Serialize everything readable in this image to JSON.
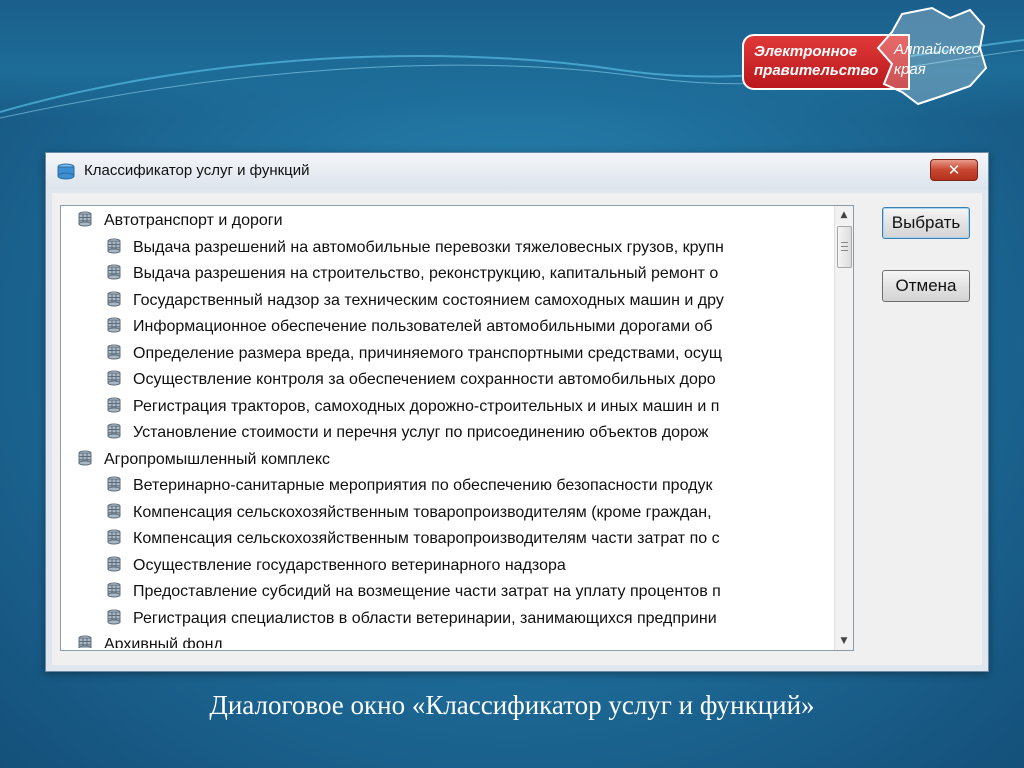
{
  "logo": {
    "red_text": "Электронное\nправительство",
    "map_text": "Алтайского\nкрая"
  },
  "dialog": {
    "title": "Классификатор услуг и функций",
    "close_label": "✕",
    "buttons": {
      "select": "Выбрать",
      "cancel": "Отмена"
    },
    "tree": [
      {
        "type": "group",
        "label": "Автотранспорт и дороги"
      },
      {
        "type": "child",
        "label": "Выдача разрешений на автомобильные перевозки тяжеловесных грузов, крупн"
      },
      {
        "type": "child",
        "label": "Выдача разрешения на строительство, реконструкцию, капитальный ремонт о"
      },
      {
        "type": "child",
        "label": "Государственный надзор за техническим состоянием самоходных машин и дру"
      },
      {
        "type": "child",
        "label": "Информационное обеспечение пользователей автомобильными дорогами об"
      },
      {
        "type": "child",
        "label": "Определение размера вреда, причиняемого транспортными средствами, осущ"
      },
      {
        "type": "child",
        "label": "Осуществление контроля за обеспечением сохранности автомобильных доро"
      },
      {
        "type": "child",
        "label": "Регистрация тракторов, самоходных дорожно-строительных и иных машин и п"
      },
      {
        "type": "child",
        "label": "Установление стоимости и перечня услуг по присоединению объектов дорож"
      },
      {
        "type": "group",
        "label": "Агропромышленный комплекс"
      },
      {
        "type": "child",
        "label": "Ветеринарно-санитарные мероприятия по обеспечению безопасности продук"
      },
      {
        "type": "child",
        "label": "Компенсация сельскохозяйственным товаропроизводителям (кроме граждан,"
      },
      {
        "type": "child",
        "label": "Компенсация сельскохозяйственным товаропроизводителям части затрат по с"
      },
      {
        "type": "child",
        "label": "Осуществление государственного ветеринарного надзора"
      },
      {
        "type": "child",
        "label": "Предоставление субсидий на возмещение части затрат на уплату процентов п"
      },
      {
        "type": "child",
        "label": "Регистрация специалистов в области ветеринарии, занимающихся предприни"
      },
      {
        "type": "group",
        "label": "Архивный фонд"
      }
    ]
  },
  "caption": "Диалоговое окно «Классификатор услуг и функций»",
  "colors": {
    "background": "#1f6f9c",
    "logo_red": "#c8202a",
    "close_button": "#c7462f"
  },
  "icons": {
    "tree_item": "database-icon",
    "title": "app-icon"
  }
}
